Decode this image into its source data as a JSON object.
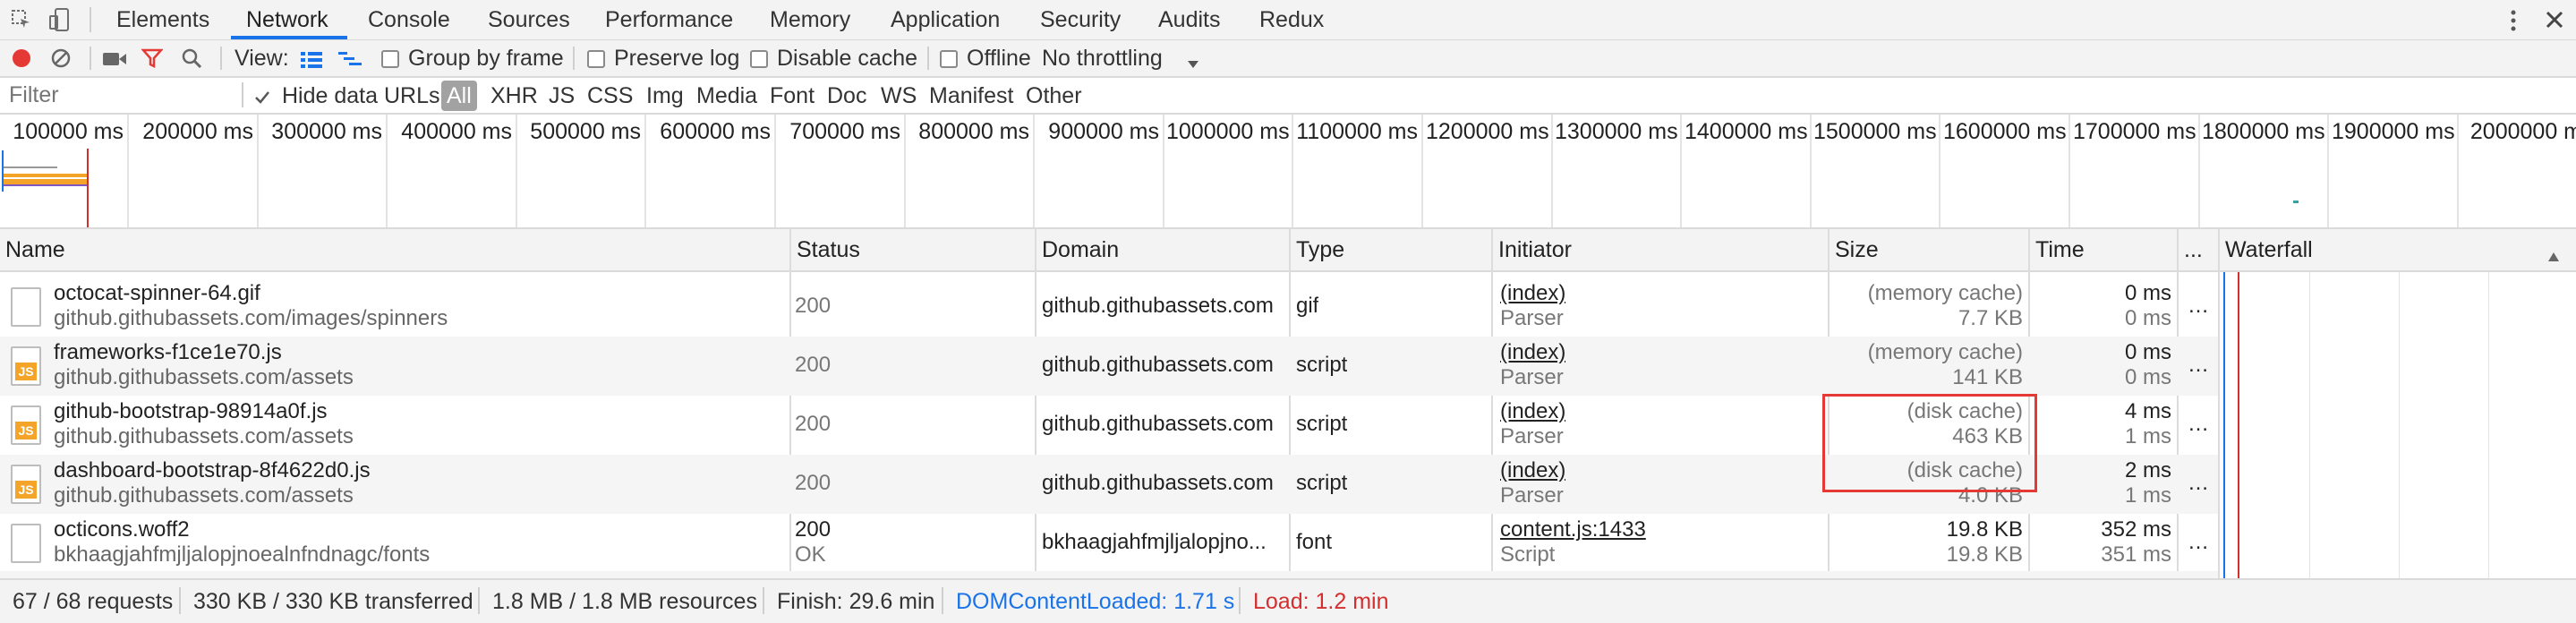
{
  "tabs": [
    "Elements",
    "Network",
    "Console",
    "Sources",
    "Performance",
    "Memory",
    "Application",
    "Security",
    "Audits",
    "Redux"
  ],
  "active_tab": "Network",
  "toolbar": {
    "view_label": "View:",
    "group_by_frame": "Group by frame",
    "preserve_log": "Preserve log",
    "disable_cache": "Disable cache",
    "offline": "Offline",
    "throttling": "No throttling"
  },
  "filter": {
    "placeholder": "Filter",
    "hide_data_urls": "Hide data URLs",
    "types": [
      "All",
      "XHR",
      "JS",
      "CSS",
      "Img",
      "Media",
      "Font",
      "Doc",
      "WS",
      "Manifest",
      "Other"
    ]
  },
  "timeline_ticks": [
    "100000 ms",
    "200000 ms",
    "300000 ms",
    "400000 ms",
    "500000 ms",
    "600000 ms",
    "700000 ms",
    "800000 ms",
    "900000 ms",
    "1000000 ms",
    "1100000 ms",
    "1200000 ms",
    "1300000 ms",
    "1400000 ms",
    "1500000 ms",
    "1600000 ms",
    "1700000 ms",
    "1800000 ms",
    "1900000 ms",
    "2000000 m"
  ],
  "columns": {
    "name": "Name",
    "status": "Status",
    "domain": "Domain",
    "type": "Type",
    "initiator": "Initiator",
    "size": "Size",
    "time": "Time",
    "more": "...",
    "waterfall": "Waterfall"
  },
  "rows": [
    {
      "name": "octocat-spinner-64.gif",
      "path": "github.githubassets.com/images/spinners",
      "status": "200",
      "status2": "",
      "domain": "github.githubassets.com",
      "type": "gif",
      "initiator": "(index)",
      "initiator2": "Parser",
      "size1": "(memory cache)",
      "size2": "7.7 KB",
      "time1": "0 ms",
      "time2": "0 ms",
      "icon": "image-file-icon"
    },
    {
      "name": "frameworks-f1ce1e70.js",
      "path": "github.githubassets.com/assets",
      "status": "200",
      "status2": "",
      "domain": "github.githubassets.com",
      "type": "script",
      "initiator": "(index)",
      "initiator2": "Parser",
      "size1": "(memory cache)",
      "size2": "141 KB",
      "time1": "0 ms",
      "time2": "0 ms",
      "icon": "js-file-icon"
    },
    {
      "name": "github-bootstrap-98914a0f.js",
      "path": "github.githubassets.com/assets",
      "status": "200",
      "status2": "",
      "domain": "github.githubassets.com",
      "type": "script",
      "initiator": "(index)",
      "initiator2": "Parser",
      "size1": "(disk cache)",
      "size2": "463 KB",
      "time1": "4 ms",
      "time2": "1 ms",
      "icon": "js-file-icon"
    },
    {
      "name": "dashboard-bootstrap-8f4622d0.js",
      "path": "github.githubassets.com/assets",
      "status": "200",
      "status2": "",
      "domain": "github.githubassets.com",
      "type": "script",
      "initiator": "(index)",
      "initiator2": "Parser",
      "size1": "(disk cache)",
      "size2": "4.0 KB",
      "time1": "2 ms",
      "time2": "1 ms",
      "icon": "js-file-icon"
    },
    {
      "name": "octicons.woff2",
      "path": "bkhaagjahfmjljalopjnoealnfndnagc/fonts",
      "status": "200",
      "status2": "OK",
      "domain": "bkhaagjahfmjljalopjno...",
      "type": "font",
      "initiator": "content.js:1433",
      "initiator2": "Script",
      "size1": "19.8 KB",
      "size2": "19.8 KB",
      "time1": "352 ms",
      "time2": "351 ms",
      "icon": "file-icon"
    }
  ],
  "statusbar": {
    "requests": "67 / 68 requests",
    "transferred": "330 KB / 330 KB transferred",
    "resources": "1.8 MB / 1.8 MB resources",
    "finish": "Finish: 29.6 min",
    "dcl": "DOMContentLoaded: 1.71 s",
    "load": "Load: 1.2 min"
  },
  "colors": {
    "accent": "#1a73e8",
    "record": "#e53935",
    "dcl": "#1a73e8",
    "load": "#d32f2f",
    "highlight": "#e53935"
  }
}
